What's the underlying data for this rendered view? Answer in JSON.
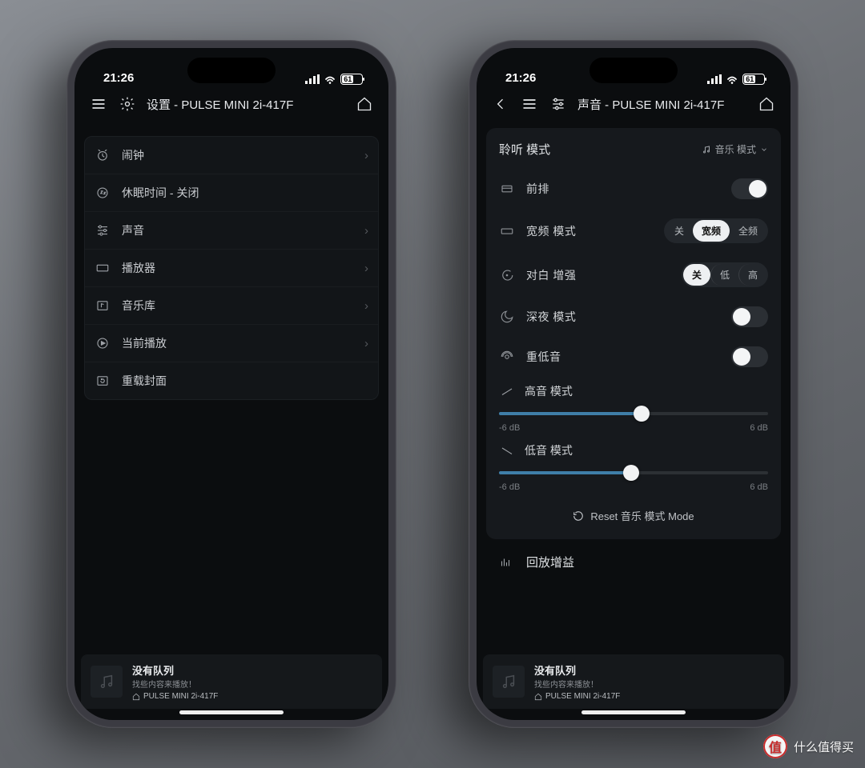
{
  "status": {
    "time": "21:26",
    "battery": "61"
  },
  "left": {
    "header_title": "设置 - PULSE MINI 2i-417F",
    "rows": [
      {
        "icon": "alarm",
        "label": "闹钟"
      },
      {
        "icon": "sleep",
        "label": "休眠时间 - 关闭"
      },
      {
        "icon": "sliders",
        "label": "声音"
      },
      {
        "icon": "player",
        "label": "播放器"
      },
      {
        "icon": "library",
        "label": "音乐库"
      },
      {
        "icon": "nowplay",
        "label": "当前播放"
      },
      {
        "icon": "reload",
        "label": "重载封面"
      }
    ]
  },
  "right": {
    "header_title": "声音 - PULSE MINI 2i-417F",
    "listen_mode_label": "聆听 模式",
    "listen_mode_value": "音乐 模式",
    "front_row_label": "前排",
    "wide_mode_label": "宽频 模式",
    "wide_options": {
      "off": "关",
      "wide": "宽频",
      "full": "全频"
    },
    "dialog_label": "对白 增强",
    "dialog_options": {
      "off": "关",
      "low": "低",
      "high": "高"
    },
    "late_night_label": "深夜 模式",
    "bass_label": "重低音",
    "treble_label": "高音 模式",
    "bass_mode_label": "低音 模式",
    "slider_min": "-6 dB",
    "slider_max": "6 dB",
    "reset_label": "Reset 音乐 模式 Mode",
    "replay_gain_label": "回放增益"
  },
  "miniplayer": {
    "title": "没有队列",
    "subtitle": "找些内容来播放！",
    "device": "PULSE MINI 2i-417F"
  },
  "watermark": "什么值得买"
}
